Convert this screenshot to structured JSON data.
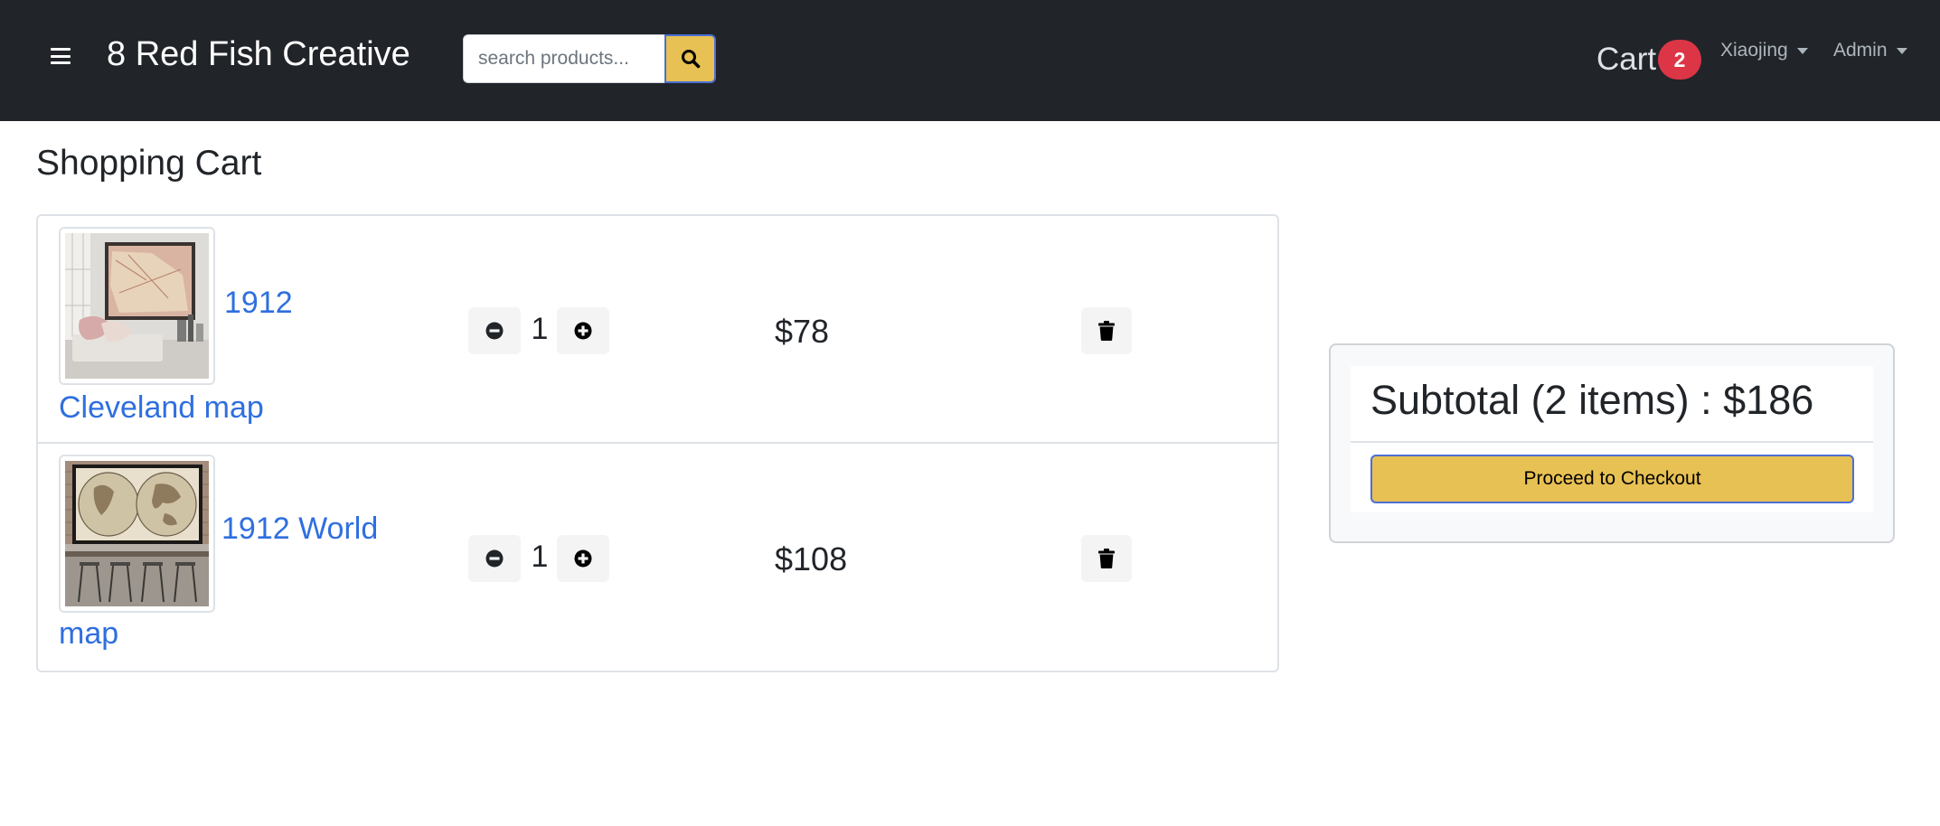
{
  "navbar": {
    "brand": "8 Red Fish Creative",
    "search_placeholder": "search products...",
    "cart_label": "Cart",
    "cart_count": "2",
    "user_menu": "Xiaojing",
    "admin_menu": "Admin",
    "icons": [
      "hamburger-icon",
      "search-icon"
    ]
  },
  "page": {
    "title": "Shopping Cart"
  },
  "cart_items": [
    {
      "name_line1": "1912",
      "name_line2": "Cleveland map",
      "quantity": "1",
      "price": "$78",
      "image": "framed-cleveland-map-photo"
    },
    {
      "name_line1": "1912 World",
      "name_line2": "map",
      "quantity": "1",
      "price": "$108",
      "image": "framed-world-map-photo"
    }
  ],
  "summary": {
    "subtotal": "Subtotal (2 items) : $186",
    "checkout_label": "Proceed to Checkout"
  },
  "colors": {
    "navbar_bg": "#212529",
    "accent_yellow": "#e8c154",
    "link_blue": "#2f6fdf",
    "badge_red": "#dc3545"
  }
}
